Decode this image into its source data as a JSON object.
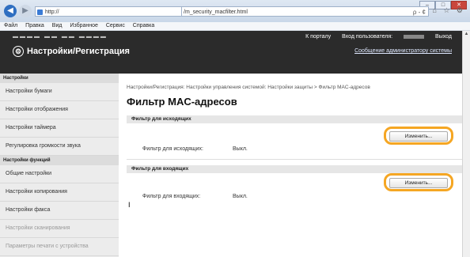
{
  "browser": {
    "url": "http://",
    "url_tail": "/m_security_macfilter.html",
    "search_label": "ρ - ¢",
    "toolbar_icons": "⌂ ☆ ⚙",
    "menu": [
      "Файл",
      "Правка",
      "Вид",
      "Избранное",
      "Сервис",
      "Справка"
    ]
  },
  "header": {
    "brand": "Настройки/Регистрация",
    "portal_link": "К порталу",
    "login_user": "Вход пользователя:",
    "logout": "Выход",
    "admin_message": "Сообщение администратору системы"
  },
  "sidebar": {
    "section1": "Настройки",
    "items1": [
      "Настройки бумаги",
      "Настройки отображения",
      "Настройки таймера",
      "Регулировка громкости звука"
    ],
    "section2": "Настройки функций",
    "items2": [
      "Общие настройки",
      "Настройки копирования",
      "Настройки факса",
      "Настройки сканирования",
      "Параметры печати с устройства"
    ]
  },
  "main": {
    "breadcrumb": "Настройки/Регистрация: Настройки управления системой: Настройки защиты > Фильтр MAC-адресов",
    "title": "Фильтр MAC-адресов",
    "outgoing": {
      "header": "Фильтр для исходящих",
      "edit_label": "Изменить...",
      "label": "Фильтр для исходящих:",
      "value": "Выкл."
    },
    "incoming": {
      "header": "Фильтр для входящих",
      "edit_label": "Изменить...",
      "label": "Фильтр для входящих:",
      "value": "Выкл."
    }
  },
  "colors": {
    "highlight": "#f5a623",
    "header_bg": "#2b2b2b"
  }
}
